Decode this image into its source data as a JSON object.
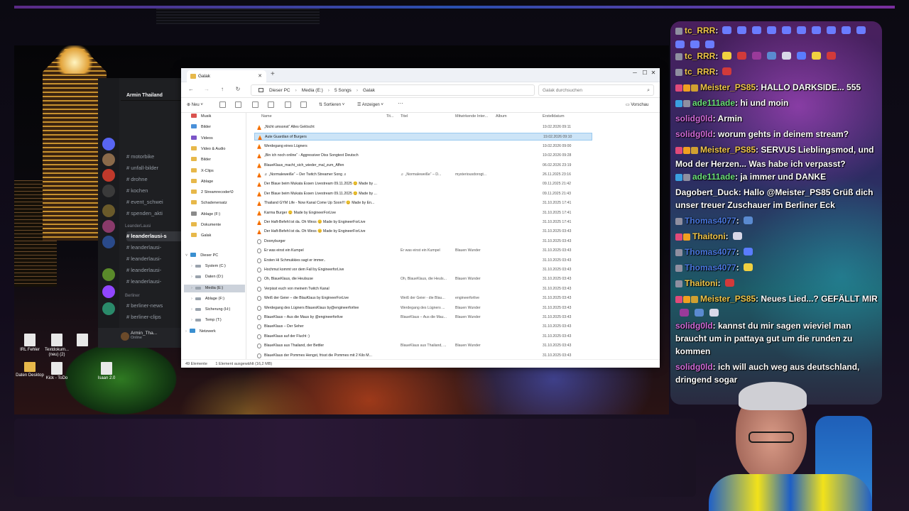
{
  "desktop": {
    "icons": [
      {
        "label": "IRL Fehler",
        "type": "doc"
      },
      {
        "label": "Textdokum... (neu) (2)",
        "type": "doc"
      },
      {
        "label": "",
        "type": "doc"
      },
      {
        "label": "Daten Desktop",
        "type": "folder"
      },
      {
        "label": "Kick - ToDo",
        "type": "doc"
      },
      {
        "label": "Isaan 2.0",
        "type": "doc"
      }
    ]
  },
  "discord": {
    "server_name": "Armin Thailand",
    "channels": [
      "motorbike",
      "unfall-bilder",
      "drohne",
      "kochen",
      "event_schwei",
      "spenden_akti"
    ],
    "category1": "LeanderLausi",
    "channels2": [
      "leanderlausi-s",
      "leanderlausi-",
      "leanderlausi-",
      "leanderlausi-",
      "leanderlausi-"
    ],
    "category2": "Berliner",
    "channels3": [
      "berliner-news",
      "berliner-clips"
    ],
    "user": {
      "name": "Armin_Tha...",
      "status": "Online"
    }
  },
  "explorer": {
    "tab_title": "Galak",
    "breadcrumb": [
      "Dieser PC",
      "Media (E:)",
      "5 Songs",
      "Galak"
    ],
    "search_placeholder": "Galak durchsuchen",
    "toolbar": {
      "new": "Neu",
      "sort": "Sortieren",
      "view": "Anzeigen",
      "more": "···",
      "preview": "Vorschau"
    },
    "nav_quick": [
      {
        "label": "Musik",
        "color": "#d9534f",
        "pin": true
      },
      {
        "label": "Bilder",
        "color": "#4a90d9",
        "pin": true
      },
      {
        "label": "Videos",
        "color": "#7b55c7",
        "pin": true
      },
      {
        "label": "Video & Audio",
        "color": "#e7b84a",
        "pin": true
      },
      {
        "label": "Bilder",
        "color": "#e7b84a",
        "pin": true
      },
      {
        "label": "X-Clips",
        "color": "#e7b84a",
        "pin": true
      },
      {
        "label": "Ablage",
        "color": "#e7b84a",
        "pin": true
      },
      {
        "label": "2 Streamrecoder\\0",
        "color": "#e7b84a",
        "pin": true
      },
      {
        "label": "Schadenersatz",
        "color": "#e7b84a",
        "pin": true
      },
      {
        "label": "Ablage (F:)",
        "color": "#8a8a8a",
        "pin": true
      },
      {
        "label": "Dokumente",
        "color": "#e7b84a",
        "pin": true
      },
      {
        "label": "Galak",
        "color": "#e7b84a",
        "pin": false
      }
    ],
    "nav_pc": {
      "label": "Dieser PC",
      "drives": [
        "System (C:)",
        "Daten (D:)",
        "Media (E:)",
        "Ablage (F:)",
        "Sicherung (H:)",
        "Temp (T:)"
      ],
      "selected": "Media (E:)"
    },
    "nav_network": "Netzwerk",
    "columns": {
      "name": "Name",
      "title": "Titel",
      "artists": "Mitwirkende Inter...",
      "album": "Album",
      "created": "Erstelldatum"
    },
    "files": [
      {
        "name": "„Nicht umsonst“ Alles Gelöscht",
        "title": "",
        "artist": "",
        "date": "19.02.2026 09:11",
        "icon": "vlc"
      },
      {
        "name": "Aute Guardian of Burgers",
        "title": "",
        "artist": "",
        "date": "19.02.2026 09:10",
        "icon": "vlc",
        "selected": true
      },
      {
        "name": "Werdegang eines Lügners",
        "title": "",
        "artist": "",
        "date": "19.02.2026 09:00",
        "icon": "vlc"
      },
      {
        "name": "„Bin ich noch online“ - Aggressiver Diss Songtext Deutsch",
        "title": "",
        "artist": "",
        "date": "19.02.2026 09:28",
        "icon": "vlc"
      },
      {
        "name": "BlaueKlaus_macht_sich_wieder_mal_zum_Affen",
        "title": "",
        "artist": "",
        "date": "06.02.2026 23:19",
        "icon": "vlc"
      },
      {
        "name": "♬ „Normaleweiße“ – Der Twitch Streamer Song ♬",
        "title": "♬ „Normaleweiße“ – D...",
        "artist": "mysteriousdorogt...",
        "date": "26.11.2025 23:16",
        "icon": "vlc"
      },
      {
        "name": "Der Blaue beim Mukata Essen Livestream 09.11.2025 😊 Made by ...",
        "title": "",
        "artist": "",
        "date": "09.11.2025 21:42",
        "icon": "vlc"
      },
      {
        "name": "Der Blaue beim Mukata Essen Livestream 09.11.2025 😊 Made by ...",
        "title": "",
        "artist": "",
        "date": "09.11.2025 21:43",
        "icon": "vlc"
      },
      {
        "name": "Thailand GYM Life - Now Kanal Come Up Soon!!! 😊 Made by En...",
        "title": "",
        "artist": "",
        "date": "31.10.2025 17:41",
        "icon": "vlc"
      },
      {
        "name": "Karma Burger 😊 Made by EngineerForLive",
        "title": "",
        "artist": "",
        "date": "31.10.2025 17:41",
        "icon": "vlc"
      },
      {
        "name": "Der Haft-Befehl ist da. Oh Wess 😊 Made by EngineerForLive",
        "title": "",
        "artist": "",
        "date": "31.10.2025 17:41",
        "icon": "vlc"
      },
      {
        "name": "Der Haft-Befehl ist da. Oh Wess 😊 Made by EngineerForLive",
        "title": "",
        "artist": "",
        "date": "31.10.2025 03:43",
        "icon": "vlc"
      },
      {
        "name": "Doonyburger",
        "title": "",
        "artist": "",
        "date": "31.10.2025 03:43",
        "icon": "mp4"
      },
      {
        "name": "Er was einst ein Kumpel",
        "title": "Er was einst ein Kumpel",
        "artist": "Blauen Wunder",
        "date": "31.10.2025 03:43",
        "icon": "mp4"
      },
      {
        "name": "Ersten Hi Schmukkies sagt er immer.. ",
        "title": "",
        "artist": "",
        "date": "31.10.2025 03:43",
        "icon": "mp4"
      },
      {
        "name": "Hochmut kommt vor dem Fall by EngineerforLive",
        "title": "",
        "artist": "",
        "date": "31.10.2025 03:43",
        "icon": "mp4"
      },
      {
        "name": "Oh, BlaueKlaus, die Heulsuse",
        "title": "Oh, BlaueKlaus, die Heuls...",
        "artist": "Blauen Wunder",
        "date": "31.10.2025 03:43",
        "icon": "mp4"
      },
      {
        "name": "Verpisst euch von meinem Twitch Kanal",
        "title": "",
        "artist": "",
        "date": "31.10.2025 03:43",
        "icon": "mp4"
      },
      {
        "name": "Weiß der Geier – die BlauKlaus by EngineerForLive",
        "title": "Weiß der Geier - die Blau...",
        "artist": "engineerforlive",
        "date": "31.10.2025 03:43",
        "icon": "mp4"
      },
      {
        "name": "Werdegang des Lügners BlauesKlaus by@engineerforlive",
        "title": "Werdegang des Lügners ...",
        "artist": "Blauen Wunder",
        "date": "31.10.2025 03:43",
        "icon": "mp4"
      },
      {
        "name": "BlaueKlaus – Aus die Maus by @engineerforlive",
        "title": "BlaueKlaus – Aus die Mau...",
        "artist": "Blauen Wunder",
        "date": "31.10.2025 03:43",
        "icon": "mp4"
      },
      {
        "name": "BlaueKlaus – Der Seher",
        "title": "",
        "artist": "",
        "date": "31.10.2025 03:43",
        "icon": "mp4"
      },
      {
        "name": "BlaueKlaus auf der Flucht :)",
        "title": "",
        "artist": "",
        "date": "31.10.2025 03:43",
        "icon": "mp4"
      },
      {
        "name": "BlaueKlaus aus Thailand, der Bettler",
        "title": "BlaueKlaus aus Thailand, ...",
        "artist": "Blauen Wunder",
        "date": "31.10.2025 03:43",
        "icon": "mp4"
      },
      {
        "name": "BlaueKlaus der Pommes Hengst, frisst die Pommes mit 2 Kilo M...",
        "title": "",
        "artist": "",
        "date": "31.10.2025 03:43",
        "icon": "mp4"
      }
    ],
    "status": {
      "count": "49 Elemente",
      "selection": "1 Element ausgewählt (16,2 MB)"
    }
  },
  "chat": {
    "messages": [
      {
        "user": "tc_RRR",
        "text": ":",
        "color": "#f0c64a",
        "badges": [
          "#8f8fa0"
        ],
        "emote_row": true
      },
      {
        "user": "tc_RRR",
        "text": ":",
        "color": "#f0c64a",
        "badges": [
          "#8f8fa0"
        ],
        "emotes": 8
      },
      {
        "user": "tc_RRR",
        "text": ":",
        "color": "#f0c64a",
        "badges": [
          "#8f8fa0"
        ],
        "emotes": 1
      },
      {
        "user": "Meister_PS85",
        "text": ": HALLO DARKSIDE... 555",
        "color": "#f0c64a",
        "badges": [
          "#e04a7a",
          "#f0a020",
          "#d0a030"
        ]
      },
      {
        "user": "ade111ade",
        "text": ": hi und moin",
        "color": "#6be07a",
        "badges": [
          "#3aa0e0",
          "#8f8fa0"
        ]
      },
      {
        "user": "solidg0ld",
        "text": ": Armin",
        "color": "#d06ad8",
        "badges": []
      },
      {
        "user": "solidg0ld",
        "text": ": worum gehts in deinem stream?",
        "color": "#d06ad8",
        "badges": []
      },
      {
        "user": "Meister_PS85",
        "text": ": SERVUS Lieblingsmod, und Mod der Herzen... Was habe ich verpasst?",
        "color": "#f0c64a",
        "badges": [
          "#e04a7a",
          "#f0a020",
          "#d0a030"
        ]
      },
      {
        "user": "ade111ade",
        "text": ": ja immer und DANKE",
        "color": "#6be07a",
        "badges": [
          "#3aa0e0",
          "#8f8fa0"
        ]
      },
      {
        "user": "Dagobert_Duck",
        "text": ": Hallo @Meister_PS85 Grüß dich unser treuer Zuschauer im Berliner Eck",
        "color": "#ffffff",
        "badges": []
      },
      {
        "user": "Thomas4077",
        "text": ":",
        "color": "#4a78e0",
        "badges": [
          "#8f8fa0"
        ],
        "emotes": 1
      },
      {
        "user": "Thaitoni",
        "text": ":",
        "color": "#f0c64a",
        "badges": [
          "#e04a7a",
          "#f0a020"
        ],
        "emotes": 1
      },
      {
        "user": "Thomas4077",
        "text": ":",
        "color": "#4a78e0",
        "badges": [
          "#8f8fa0"
        ],
        "emotes": 1
      },
      {
        "user": "Thomas4077",
        "text": ":",
        "color": "#4a78e0",
        "badges": [
          "#8f8fa0"
        ],
        "emotes": 1
      },
      {
        "user": "Thaitoni",
        "text": ":",
        "color": "#f0c64a",
        "badges": [
          "#8f8fa0"
        ],
        "emotes": 1
      },
      {
        "user": "Meister_PS85",
        "text": ": Neues Lied...? GEFÄLLT MIR",
        "color": "#f0c64a",
        "badges": [
          "#e04a7a",
          "#f0a020",
          "#d0a030"
        ],
        "emotes": 3
      },
      {
        "user": "solidg0ld",
        "text": ": kannst du mir sagen wieviel man braucht um in pattaya gut um die runden zu kommen",
        "color": "#d06ad8",
        "badges": []
      },
      {
        "user": "solidg0ld",
        "text": ": ich will auch weg aus deutschland, dringend sogar",
        "color": "#d06ad8",
        "badges": []
      }
    ]
  }
}
